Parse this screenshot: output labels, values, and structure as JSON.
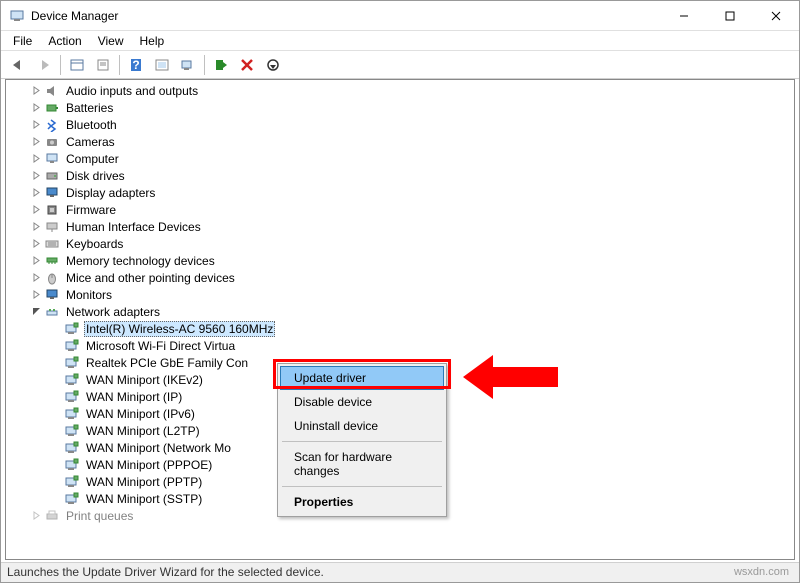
{
  "window": {
    "title": "Device Manager"
  },
  "menu": {
    "file": "File",
    "action": "Action",
    "view": "View",
    "help": "Help"
  },
  "tree": {
    "categories": [
      {
        "label": "Audio inputs and outputs",
        "expanded": false
      },
      {
        "label": "Batteries",
        "expanded": false
      },
      {
        "label": "Bluetooth",
        "expanded": false
      },
      {
        "label": "Cameras",
        "expanded": false
      },
      {
        "label": "Computer",
        "expanded": false
      },
      {
        "label": "Disk drives",
        "expanded": false
      },
      {
        "label": "Display adapters",
        "expanded": false
      },
      {
        "label": "Firmware",
        "expanded": false
      },
      {
        "label": "Human Interface Devices",
        "expanded": false
      },
      {
        "label": "Keyboards",
        "expanded": false
      },
      {
        "label": "Memory technology devices",
        "expanded": false
      },
      {
        "label": "Mice and other pointing devices",
        "expanded": false
      },
      {
        "label": "Monitors",
        "expanded": false
      },
      {
        "label": "Network adapters",
        "expanded": true,
        "children": [
          {
            "label": "Intel(R) Wireless-AC 9560 160MHz",
            "selected": true
          },
          {
            "label": "Microsoft Wi-Fi Direct Virtua"
          },
          {
            "label": "Realtek PCIe GbE Family Con"
          },
          {
            "label": "WAN Miniport (IKEv2)"
          },
          {
            "label": "WAN Miniport (IP)"
          },
          {
            "label": "WAN Miniport (IPv6)"
          },
          {
            "label": "WAN Miniport (L2TP)"
          },
          {
            "label": "WAN Miniport (Network Mo"
          },
          {
            "label": "WAN Miniport (PPPOE)"
          },
          {
            "label": "WAN Miniport (PPTP)"
          },
          {
            "label": "WAN Miniport (SSTP)"
          }
        ]
      },
      {
        "label": "Print queues",
        "expanded": false,
        "cut": true
      }
    ]
  },
  "context_menu": {
    "update": "Update driver",
    "disable": "Disable device",
    "uninstall": "Uninstall device",
    "scan": "Scan for hardware changes",
    "properties": "Properties"
  },
  "status": {
    "text": "Launches the Update Driver Wizard for the selected device."
  },
  "watermark": "wsxdn.com"
}
